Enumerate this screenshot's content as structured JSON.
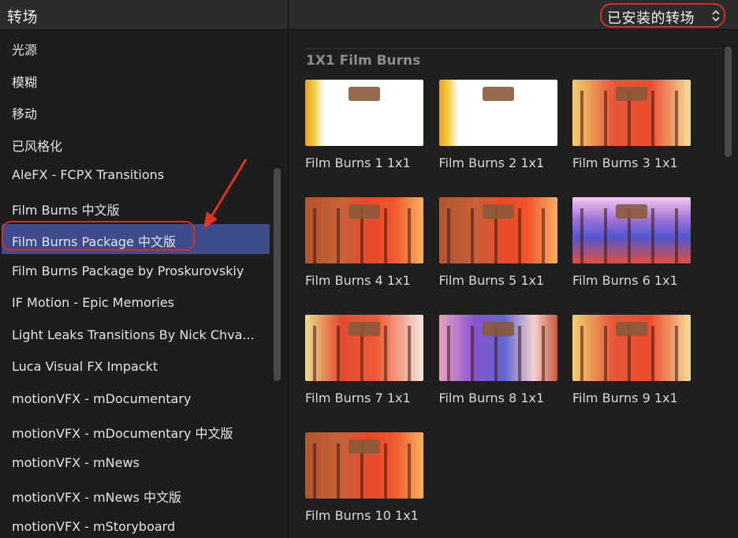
{
  "header": {
    "title": "转场",
    "filter_label": "已安装的转场"
  },
  "sidebar": {
    "items": [
      {
        "label": "光源"
      },
      {
        "label": "模糊"
      },
      {
        "label": "移动"
      },
      {
        "label": "已风格化"
      },
      {
        "label": "AleFX - FCPX Transitions"
      },
      {
        "label": "Film Burns 中文版"
      },
      {
        "label": "Film Burns Package 中文版",
        "selected": true
      },
      {
        "label": "Film Burns Package by Proskurovskiy"
      },
      {
        "label": "IF Motion - Epic Memories"
      },
      {
        "label": "Light Leaks Transitions By Nick Chva..."
      },
      {
        "label": "Luca Visual FX Impackt"
      },
      {
        "label": "motionVFX - mDocumentary"
      },
      {
        "label": "motionVFX - mDocumentary 中文版"
      },
      {
        "label": "motionVFX - mNews"
      },
      {
        "label": "motionVFX - mNews 中文版"
      },
      {
        "label": "motionVFX - mStoryboard"
      }
    ]
  },
  "content": {
    "section_title": "1X1 Film Burns",
    "tiles": [
      {
        "caption": "Film Burns 1 1x1",
        "style": "white"
      },
      {
        "caption": "Film Burns 2 1x1",
        "style": "white"
      },
      {
        "caption": "Film Burns 3 1x1",
        "style": "fire-light"
      },
      {
        "caption": "Film Burns 4 1x1",
        "style": "fire"
      },
      {
        "caption": "Film Burns 5 1x1",
        "style": "fire"
      },
      {
        "caption": "Film Burns 6 1x1",
        "style": "purple"
      },
      {
        "caption": "Film Burns 7 1x1",
        "style": "mixed"
      },
      {
        "caption": "Film Burns 8 1x1",
        "style": "purple2"
      },
      {
        "caption": "Film Burns 9 1x1",
        "style": "fire-light"
      },
      {
        "caption": "Film Burns 10 1x1",
        "style": "fire"
      }
    ]
  },
  "colors": {
    "selection": "#3e4b8c",
    "annotation": "#d6301e"
  }
}
